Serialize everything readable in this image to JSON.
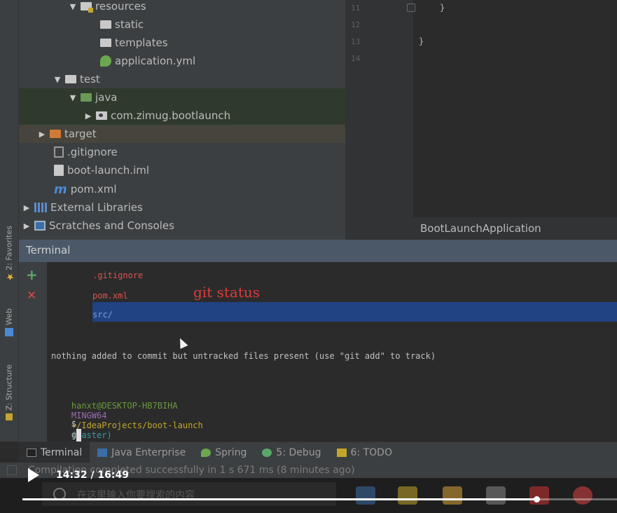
{
  "project_tree": {
    "items": [
      {
        "label": "resources",
        "arrow": "▼",
        "icon": "resources-folder-icon"
      },
      {
        "label": "static",
        "arrow": "",
        "icon": "folder-icon"
      },
      {
        "label": "templates",
        "arrow": "",
        "icon": "folder-icon"
      },
      {
        "label": "application.yml",
        "arrow": "",
        "icon": "spring-yml-icon"
      },
      {
        "label": "test",
        "arrow": "▼",
        "icon": "folder-icon"
      },
      {
        "label": "java",
        "arrow": "▼",
        "icon": "test-sources-folder-icon"
      },
      {
        "label": "com.zimug.bootlaunch",
        "arrow": "▶",
        "icon": "package-icon"
      },
      {
        "label": "target",
        "arrow": "▶",
        "icon": "excluded-folder-icon"
      },
      {
        "label": ".gitignore",
        "arrow": "",
        "icon": "file-icon"
      },
      {
        "label": "boot-launch.iml",
        "arrow": "",
        "icon": "iml-file-icon"
      },
      {
        "label": "pom.xml",
        "arrow": "",
        "icon": "maven-icon"
      },
      {
        "label": "External Libraries",
        "arrow": "▶",
        "icon": "libraries-icon"
      },
      {
        "label": "Scratches and Consoles",
        "arrow": "▶",
        "icon": "scratches-icon"
      }
    ]
  },
  "editor": {
    "line_numbers": [
      "11",
      "12",
      "13",
      "14"
    ],
    "code_lines": [
      "}",
      "",
      "}",
      ""
    ],
    "breadcrumb": "BootLaunchApplication"
  },
  "left_strip": {
    "favorites": "2: Favorites",
    "web": "Web",
    "structure": "Z: Structure"
  },
  "terminal": {
    "title": "Terminal",
    "add_symbol": "+",
    "close_symbol": "✕",
    "annotation": "git status",
    "lines": {
      "gitignore": ".gitignore",
      "pom": "pom.xml",
      "src": "src/",
      "nothing_added": "nothing added to commit but untracked files present (use \"git add\" to track)",
      "prompt_user": "hanxt@DESKTOP-HB7BIHA",
      "prompt_env": "MINGW64",
      "prompt_path": "~/IdeaProjects/boot-launch",
      "prompt_branch": "(master)",
      "prompt_symbol": "$",
      "typed": "g"
    },
    "colors": {
      "untracked": "#d9534f",
      "prompt_user": "#6a9a3a",
      "prompt_env": "#9b6ab0",
      "prompt_path": "#c3a62b",
      "prompt_branch": "#3a9ab0",
      "selection": "#214283"
    }
  },
  "bottom_tabs": [
    {
      "label": "Terminal",
      "icon": "terminal-icon",
      "active": true
    },
    {
      "label": "Java Enterprise",
      "icon": "java-enterprise-icon",
      "active": false
    },
    {
      "label": "Spring",
      "icon": "spring-icon",
      "active": false
    },
    {
      "label": "5: Debug",
      "icon": "debug-icon",
      "active": false
    },
    {
      "label": "6: TODO",
      "icon": "todo-icon",
      "active": false
    }
  ],
  "status_bar": {
    "message": "Compilation completed successfully in 1 s 671 ms (8 minutes ago)"
  },
  "taskbar": {
    "search_placeholder": "在这里输入你要搜索的内容"
  },
  "video": {
    "time": "14:32 / 16:49",
    "progress": 0.864
  }
}
